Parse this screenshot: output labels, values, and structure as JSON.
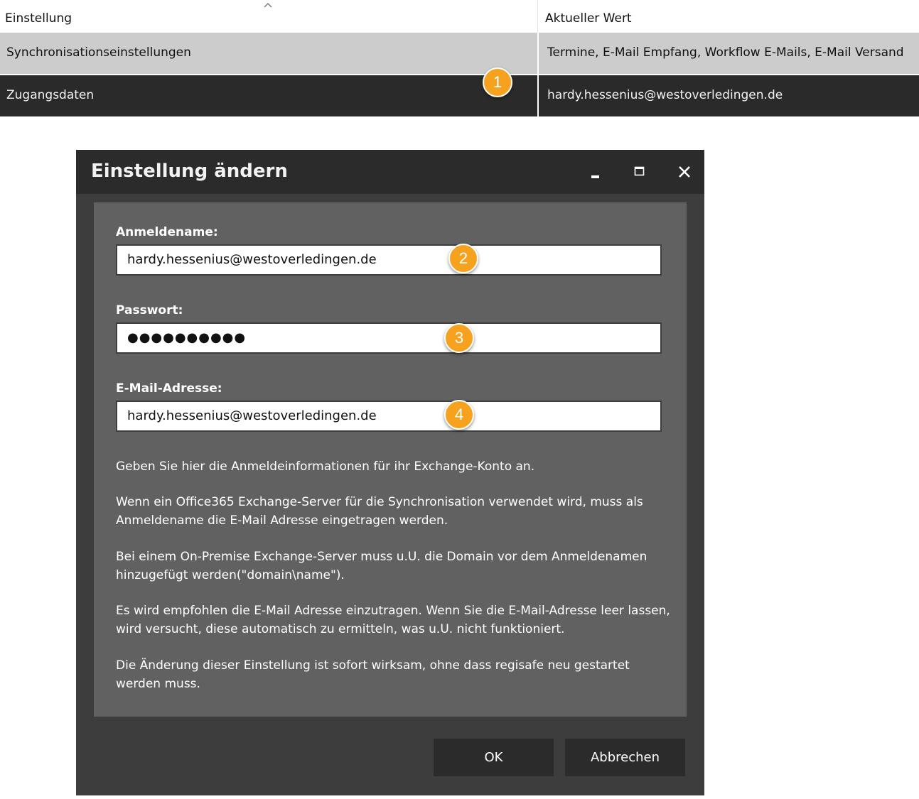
{
  "table": {
    "headers": {
      "name": "Einstellung",
      "value": "Aktueller Wert"
    },
    "rows": [
      {
        "name": "Synchronisationseinstellungen",
        "value": "Termine, E-Mail Empfang, Workflow E-Mails, E-Mail Versand"
      },
      {
        "name": "Zugangsdaten",
        "value": "hardy.hessenius@westoverledingen.de"
      }
    ]
  },
  "badges": [
    "1",
    "2",
    "3",
    "4"
  ],
  "dialog": {
    "title": "Einstellung ändern",
    "login": {
      "label": "Anmeldename:",
      "value": "hardy.hessenius@westoverledingen.de"
    },
    "password": {
      "label": "Passwort:",
      "value": "●●●●●●●●●●"
    },
    "email": {
      "label": "E-Mail-Adresse:",
      "value": "hardy.hessenius@westoverledingen.de"
    },
    "help": {
      "p1": "Geben Sie hier die Anmeldeinformationen für ihr Exchange-Konto an.",
      "p2": "Wenn ein Office365 Exchange-Server für die Synchronisation verwendet wird, muss als Anmeldename die E-Mail Adresse eingetragen werden.",
      "p3": "Bei einem On-Premise Exchange-Server muss u.U. die Domain vor dem Anmeldenamen hinzugefügt werden(\"domain\\name\").",
      "p4": "Es wird empfohlen die E-Mail Adresse einzutragen. Wenn Sie die E-Mail-Adresse leer lassen, wird versucht, diese automatisch zu ermitteln, was u.U. nicht funktioniert.",
      "p5": "Die Änderung dieser Einstellung ist sofort wirksam, ohne dass regisafe neu gestartet werden muss."
    },
    "buttons": {
      "ok": "OK",
      "cancel": "Abbrechen"
    }
  },
  "colors": {
    "badge": "#f6a21e",
    "titlebar": "#2b2b2b",
    "panel": "#616161",
    "selected_row": "#2a2a2a"
  }
}
